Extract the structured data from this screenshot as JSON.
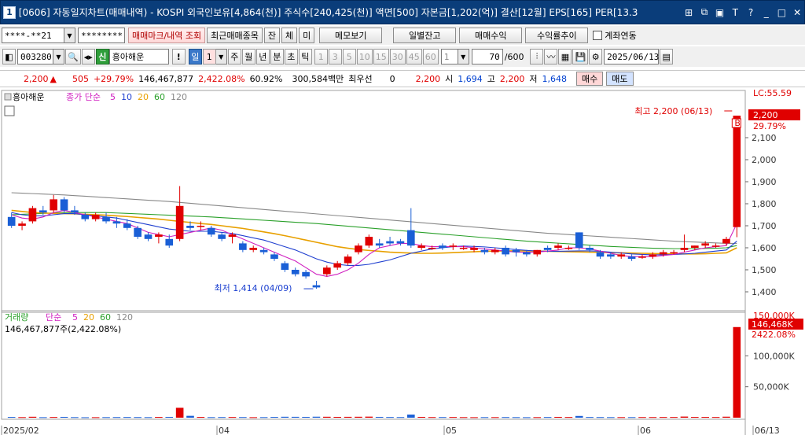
{
  "window": {
    "icon_label": "1",
    "title": "[0606] 자동일지차트(매매내역) - KOSPI 외국인보유[4,864(천)] 주식수[240,425(천)] 액면[500] 자본금[1,202(억)] 결산[12월] EPS[165] PER[13.3"
  },
  "toolbar1": {
    "account": "****-**21",
    "password": "********",
    "trade_mark_btn": "매매마크/내역 조회",
    "recent_trades_btn": "최근매매종목",
    "jan_btn": "잔",
    "che_btn": "체",
    "mi_btn": "미",
    "memo_btn": "메모보기",
    "daily_balance_btn": "일별잔고",
    "trade_profit_btn": "매매수익",
    "return_trend_btn": "수익률추이",
    "account_link_label": "계좌연동"
  },
  "toolbar2": {
    "code": "003280",
    "badge_shin": "신",
    "stock_name": "흥아해운",
    "excl": "!",
    "period_il": "일",
    "period_num": "1",
    "ju": "주",
    "wol": "월",
    "nyeon": "년",
    "bun": "분",
    "cho": "초",
    "tik": "틱",
    "intervals": [
      "1",
      "3",
      "5",
      "10",
      "15",
      "30",
      "45",
      "60"
    ],
    "interval_value": "1",
    "count": "70",
    "count_total": "/600",
    "date": "2025/06/13"
  },
  "price_bar": {
    "price": "2,200",
    "change": "505",
    "change_pct": "+29.79%",
    "volume": "146,467,877",
    "volume_pct": "2,422.08%",
    "turnover": "60.92%",
    "amount": "300,584백만",
    "priority_label": "최우선",
    "priority_val": "0",
    "ask": "2,200",
    "open_label": "시",
    "open": "1,694",
    "high_label": "고",
    "high": "2,200",
    "low_label": "저",
    "low": "1,648",
    "buy_btn": "매수",
    "sell_btn": "매도"
  },
  "chart_data": [
    {
      "type": "candlestick",
      "legend": [
        "흥아해운",
        "종가 단순",
        "5",
        "10",
        "20",
        "60",
        "120"
      ],
      "ylim": [
        1350,
        2250
      ],
      "y_ticks": [
        "2,100",
        "2,000",
        "1,900",
        "1,800",
        "1,700",
        "1,600",
        "1,500",
        "1,400"
      ],
      "x_ticks": [
        "2025/02",
        "04",
        "05",
        "06",
        "06/13"
      ],
      "annotations": {
        "high": "최고 2,200 (06/13)",
        "low": "최저 1,414 (04/09)",
        "last_price": "2,200",
        "last_pct": "29.79%",
        "lc": "LC:55.59"
      },
      "candles": [
        [
          1740,
          1760,
          1690,
          1700
        ],
        [
          1700,
          1720,
          1680,
          1710
        ],
        [
          1720,
          1790,
          1710,
          1780
        ],
        [
          1770,
          1790,
          1750,
          1760
        ],
        [
          1770,
          1840,
          1760,
          1820
        ],
        [
          1820,
          1830,
          1760,
          1770
        ],
        [
          1770,
          1790,
          1750,
          1760
        ],
        [
          1750,
          1760,
          1720,
          1730
        ],
        [
          1730,
          1760,
          1720,
          1750
        ],
        [
          1740,
          1760,
          1710,
          1720
        ],
        [
          1720,
          1740,
          1690,
          1710
        ],
        [
          1710,
          1730,
          1680,
          1690
        ],
        [
          1690,
          1700,
          1640,
          1650
        ],
        [
          1660,
          1670,
          1630,
          1640
        ],
        [
          1650,
          1670,
          1620,
          1660
        ],
        [
          1640,
          1660,
          1600,
          1610
        ],
        [
          1640,
          1880,
          1630,
          1790
        ],
        [
          1700,
          1720,
          1680,
          1690
        ],
        [
          1700,
          1720,
          1680,
          1700
        ],
        [
          1690,
          1700,
          1650,
          1660
        ],
        [
          1660,
          1670,
          1630,
          1640
        ],
        [
          1650,
          1670,
          1620,
          1660
        ],
        [
          1620,
          1630,
          1580,
          1590
        ],
        [
          1590,
          1610,
          1580,
          1600
        ],
        [
          1590,
          1600,
          1570,
          1580
        ],
        [
          1570,
          1580,
          1540,
          1550
        ],
        [
          1530,
          1540,
          1490,
          1500
        ],
        [
          1500,
          1510,
          1470,
          1480
        ],
        [
          1490,
          1500,
          1460,
          1470
        ],
        [
          1430,
          1450,
          1414,
          1420
        ],
        [
          1480,
          1520,
          1470,
          1510
        ],
        [
          1510,
          1540,
          1500,
          1530
        ],
        [
          1530,
          1570,
          1520,
          1560
        ],
        [
          1580,
          1620,
          1570,
          1610
        ],
        [
          1610,
          1660,
          1600,
          1650
        ],
        [
          1620,
          1640,
          1600,
          1610
        ],
        [
          1630,
          1650,
          1610,
          1620
        ],
        [
          1630,
          1640,
          1610,
          1620
        ],
        [
          1680,
          1780,
          1600,
          1610
        ],
        [
          1600,
          1620,
          1590,
          1610
        ],
        [
          1600,
          1610,
          1590,
          1600
        ],
        [
          1610,
          1620,
          1590,
          1600
        ],
        [
          1610,
          1620,
          1590,
          1610
        ],
        [
          1600,
          1610,
          1590,
          1600
        ],
        [
          1590,
          1610,
          1580,
          1600
        ],
        [
          1590,
          1600,
          1570,
          1580
        ],
        [
          1580,
          1600,
          1570,
          1590
        ],
        [
          1600,
          1610,
          1560,
          1570
        ],
        [
          1590,
          1600,
          1560,
          1580
        ],
        [
          1580,
          1590,
          1560,
          1570
        ],
        [
          1570,
          1590,
          1560,
          1590
        ],
        [
          1600,
          1610,
          1580,
          1590
        ],
        [
          1600,
          1620,
          1590,
          1610
        ],
        [
          1600,
          1610,
          1590,
          1600
        ],
        [
          1670,
          1670,
          1590,
          1600
        ],
        [
          1600,
          1610,
          1580,
          1590
        ],
        [
          1580,
          1590,
          1550,
          1560
        ],
        [
          1570,
          1580,
          1550,
          1560
        ],
        [
          1560,
          1580,
          1550,
          1570
        ],
        [
          1560,
          1570,
          1540,
          1550
        ],
        [
          1560,
          1570,
          1550,
          1560
        ],
        [
          1560,
          1580,
          1550,
          1570
        ],
        [
          1570,
          1590,
          1560,
          1580
        ],
        [
          1580,
          1590,
          1570,
          1580
        ],
        [
          1590,
          1660,
          1580,
          1600
        ],
        [
          1600,
          1610,
          1590,
          1610
        ],
        [
          1610,
          1630,
          1600,
          1620
        ],
        [
          1610,
          1620,
          1600,
          1610
        ],
        [
          1620,
          1650,
          1610,
          1640
        ],
        [
          1694,
          2200,
          1648,
          2200
        ]
      ],
      "ma_colors": {
        "ma5": "#d020c0",
        "ma10": "#2040d0",
        "ma20": "#e8a000",
        "ma60": "#2aa02a",
        "ma120": "#888888"
      },
      "ma_series": {
        "ma5": [
          1750,
          1735,
          1730,
          1740,
          1760,
          1770,
          1760,
          1750,
          1740,
          1730,
          1720,
          1710,
          1690,
          1670,
          1660,
          1650,
          1660,
          1670,
          1680,
          1690,
          1680,
          1660,
          1640,
          1620,
          1600,
          1580,
          1560,
          1540,
          1510,
          1480,
          1470,
          1480,
          1500,
          1530,
          1570,
          1600,
          1610,
          1620,
          1620,
          1610,
          1605,
          1605,
          1605,
          1605,
          1600,
          1595,
          1590,
          1585,
          1580,
          1580,
          1580,
          1585,
          1590,
          1600,
          1600,
          1595,
          1585,
          1575,
          1565,
          1560,
          1560,
          1560,
          1565,
          1570,
          1580,
          1590,
          1600,
          1605,
          1610,
          1710
        ],
        "ma10": [
          1760,
          1750,
          1745,
          1745,
          1750,
          1755,
          1755,
          1750,
          1745,
          1740,
          1735,
          1725,
          1715,
          1705,
          1695,
          1685,
          1680,
          1675,
          1675,
          1675,
          1670,
          1665,
          1655,
          1645,
          1635,
          1620,
          1605,
          1590,
          1570,
          1550,
          1535,
          1525,
          1520,
          1520,
          1525,
          1535,
          1545,
          1560,
          1575,
          1585,
          1595,
          1600,
          1605,
          1608,
          1606,
          1604,
          1600,
          1596,
          1592,
          1588,
          1585,
          1584,
          1584,
          1585,
          1586,
          1586,
          1584,
          1580,
          1576,
          1572,
          1570,
          1568,
          1568,
          1570,
          1572,
          1575,
          1580,
          1585,
          1590,
          1630
        ],
        "ma20": [
          1770,
          1765,
          1760,
          1758,
          1756,
          1755,
          1754,
          1752,
          1750,
          1748,
          1745,
          1742,
          1738,
          1734,
          1730,
          1725,
          1720,
          1715,
          1710,
          1706,
          1700,
          1694,
          1688,
          1680,
          1672,
          1664,
          1655,
          1645,
          1635,
          1625,
          1615,
          1605,
          1598,
          1592,
          1588,
          1584,
          1580,
          1578,
          1576,
          1575,
          1575,
          1576,
          1578,
          1580,
          1582,
          1584,
          1585,
          1586,
          1586,
          1586,
          1585,
          1584,
          1583,
          1582,
          1581,
          1580,
          1579,
          1578,
          1577,
          1576,
          1575,
          1574,
          1573,
          1572,
          1572,
          1572,
          1573,
          1575,
          1577,
          1600
        ],
        "ma60": [
          1750,
          1752,
          1754,
          1756,
          1758,
          1760,
          1760,
          1760,
          1760,
          1760,
          1758,
          1756,
          1754,
          1752,
          1750,
          1748,
          1746,
          1744,
          1742,
          1740,
          1737,
          1734,
          1731,
          1728,
          1725,
          1722,
          1719,
          1716,
          1713,
          1710,
          1706,
          1702,
          1698,
          1694,
          1690,
          1686,
          1682,
          1678,
          1674,
          1670,
          1666,
          1662,
          1658,
          1654,
          1650,
          1646,
          1642,
          1638,
          1634,
          1630,
          1627,
          1624,
          1621,
          1618,
          1615,
          1612,
          1609,
          1606,
          1604,
          1602,
          1600,
          1598,
          1597,
          1596,
          1596,
          1596,
          1597,
          1598,
          1600,
          1610
        ],
        "ma120": [
          1850,
          1848,
          1846,
          1844,
          1842,
          1840,
          1837,
          1834,
          1831,
          1828,
          1825,
          1822,
          1819,
          1816,
          1813,
          1810,
          1806,
          1802,
          1798,
          1794,
          1790,
          1786,
          1782,
          1778,
          1774,
          1770,
          1766,
          1762,
          1758,
          1754,
          1750,
          1746,
          1742,
          1738,
          1734,
          1730,
          1726,
          1722,
          1718,
          1714,
          1710,
          1706,
          1702,
          1698,
          1694,
          1690,
          1686,
          1682,
          1678,
          1674,
          1670,
          1666,
          1663,
          1660,
          1657,
          1654,
          1651,
          1648,
          1645,
          1642,
          1639,
          1636,
          1633,
          1630,
          1628,
          1626,
          1624,
          1622,
          1620,
          1620
        ]
      }
    },
    {
      "type": "bar",
      "legend": [
        "거래량",
        "단순",
        "5",
        "20",
        "60",
        "120"
      ],
      "current_volume": "146,467,877주(2,422.08%)",
      "ylim": [
        0,
        150000
      ],
      "y_ticks": [
        "100,000K",
        "50,000K"
      ],
      "last_label": "146,468K",
      "last_pct": "2422.08%",
      "top_label": "150,000K",
      "values": [
        1200,
        900,
        1500,
        800,
        1100,
        1300,
        900,
        700,
        800,
        900,
        1000,
        1100,
        1000,
        900,
        1200,
        1300,
        16000,
        3000,
        1200,
        900,
        1000,
        1100,
        1000,
        800,
        900,
        1200,
        1500,
        1400,
        1300,
        1600,
        1500,
        1300,
        1400,
        1500,
        1700,
        1300,
        1100,
        1000,
        5000,
        1300,
        1000,
        1000,
        1100,
        900,
        800,
        900,
        900,
        1000,
        900,
        800,
        900,
        1100,
        1300,
        1100,
        2800,
        1100,
        1000,
        900,
        900,
        900,
        1000,
        1000,
        1100,
        1100,
        1800,
        1200,
        1200,
        1100,
        1600,
        146468
      ]
    }
  ]
}
